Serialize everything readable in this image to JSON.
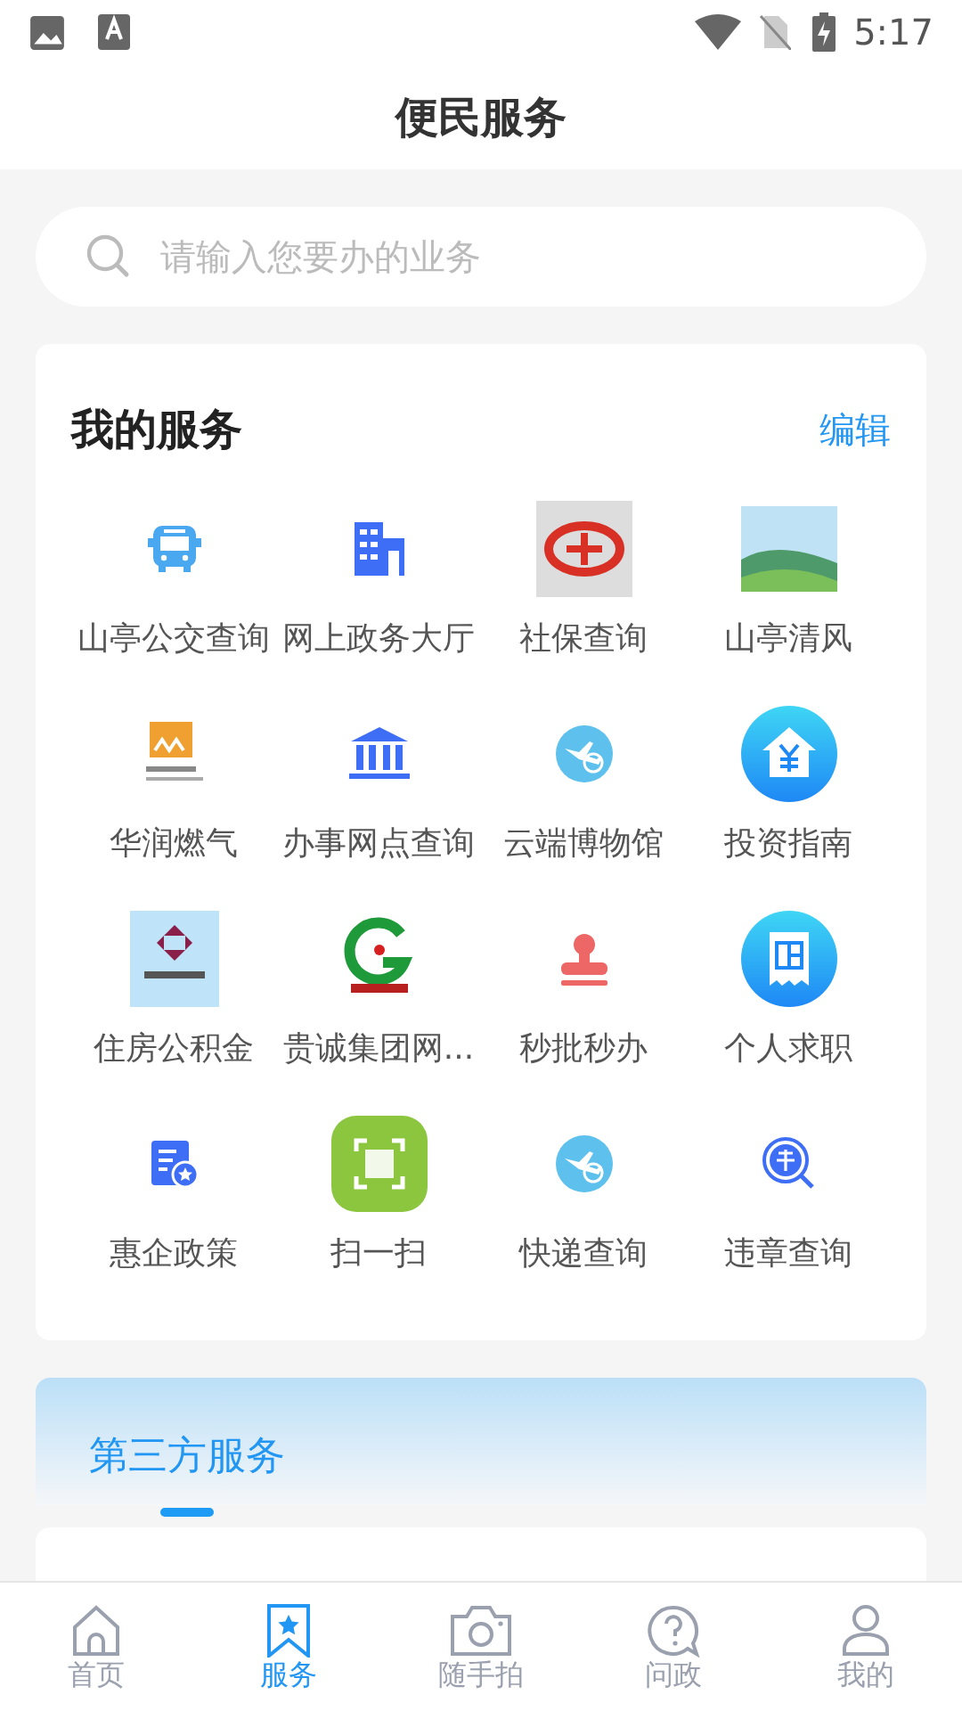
{
  "status_bar": {
    "time": "5:17"
  },
  "title": "便民服务",
  "search": {
    "placeholder": "请输入您要办的业务"
  },
  "my_services": {
    "title": "我的服务",
    "edit": "编辑",
    "items": [
      {
        "label": "山亭公交查询",
        "kind": "bus"
      },
      {
        "label": "网上政务大厅",
        "kind": "building"
      },
      {
        "label": "社保查询",
        "kind": "logo-red"
      },
      {
        "label": "山亭清风",
        "kind": "landscape"
      },
      {
        "label": "华润燃气",
        "kind": "logo-orange"
      },
      {
        "label": "办事网点查询",
        "kind": "bank"
      },
      {
        "label": "云端博物馆",
        "kind": "plane-globe"
      },
      {
        "label": "投资指南",
        "kind": "house-yen"
      },
      {
        "label": "住房公积金",
        "kind": "logo-fund"
      },
      {
        "label": "贵诚集团网...",
        "kind": "logo-green"
      },
      {
        "label": "秒批秒办",
        "kind": "stamp"
      },
      {
        "label": "个人求职",
        "kind": "receipt"
      },
      {
        "label": "惠企政策",
        "kind": "doc-star"
      },
      {
        "label": "扫一扫",
        "kind": "scan"
      },
      {
        "label": "快递查询",
        "kind": "plane-globe"
      },
      {
        "label": "违章查询",
        "kind": "violation"
      }
    ]
  },
  "third_party": {
    "tabs": [
      {
        "label": "第三方服务",
        "selected": true
      }
    ]
  },
  "bottom_nav": [
    {
      "label": "首页",
      "kind": "home",
      "selected": false
    },
    {
      "label": "服务",
      "kind": "bookmark",
      "selected": true
    },
    {
      "label": "随手拍",
      "kind": "camera",
      "selected": false
    },
    {
      "label": "问政",
      "kind": "question",
      "selected": false
    },
    {
      "label": "我的",
      "kind": "person",
      "selected": false
    }
  ]
}
